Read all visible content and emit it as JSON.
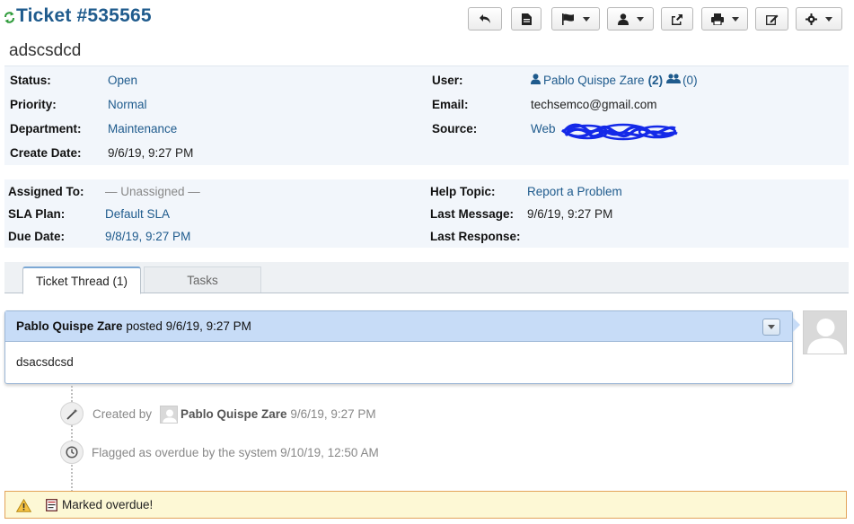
{
  "header": {
    "title": "Ticket #535565",
    "subject": "adscsdcd"
  },
  "toolbar": {
    "buttons": [
      {
        "name": "reply-icon"
      },
      {
        "name": "document-icon"
      },
      {
        "name": "flag-icon",
        "dropdown": true
      },
      {
        "name": "user-icon",
        "dropdown": true
      },
      {
        "name": "share-icon"
      },
      {
        "name": "print-icon",
        "dropdown": true
      },
      {
        "name": "edit-icon"
      },
      {
        "name": "gear-icon",
        "dropdown": true
      }
    ]
  },
  "info": {
    "status_label": "Status:",
    "status": "Open",
    "priority_label": "Priority:",
    "priority": "Normal",
    "department_label": "Department:",
    "department": "Maintenance",
    "create_date_label": "Create Date:",
    "create_date": "9/6/19, 9:27 PM",
    "user_label": "User:",
    "user": "Pablo Quispe Zare",
    "user_tickets": "(2)",
    "user_org_tickets": "(0)",
    "email_label": "Email:",
    "email": "techsemco@gmail.com",
    "source_label": "Source:",
    "source": "Web"
  },
  "assignment": {
    "assigned_to_label": "Assigned To:",
    "assigned_to": "— Unassigned —",
    "sla_plan_label": "SLA Plan:",
    "sla_plan": "Default SLA",
    "due_date_label": "Due Date:",
    "due_date": "9/8/19, 9:27 PM",
    "help_topic_label": "Help Topic:",
    "help_topic": "Report a Problem",
    "last_message_label": "Last Message:",
    "last_message": "9/6/19, 9:27 PM",
    "last_response_label": "Last Response:",
    "last_response": ""
  },
  "tabs": [
    {
      "label": "Ticket Thread (1)",
      "active": true
    },
    {
      "label": "Tasks",
      "active": false
    }
  ],
  "thread": {
    "poster": "Pablo Quispe Zare",
    "posted_text": "posted 9/6/19, 9:27 PM",
    "body": "dsacsdcsd"
  },
  "events": [
    {
      "prefix": "Created by",
      "user": "Pablo Quispe Zare",
      "time": "9/6/19, 9:27 PM",
      "icon": "magic-wand-icon"
    },
    {
      "text": "Flagged as overdue by the system 9/10/19, 12:50 AM",
      "icon": "clock-icon"
    }
  ],
  "warning": {
    "text": "Marked overdue!"
  },
  "colors": {
    "link": "#1f5b8d",
    "refresh": "#2e9b3a",
    "thread_header": "#c7dcf7",
    "warning_bg": "#fdf8d5",
    "warning_border": "#e3a35a"
  }
}
